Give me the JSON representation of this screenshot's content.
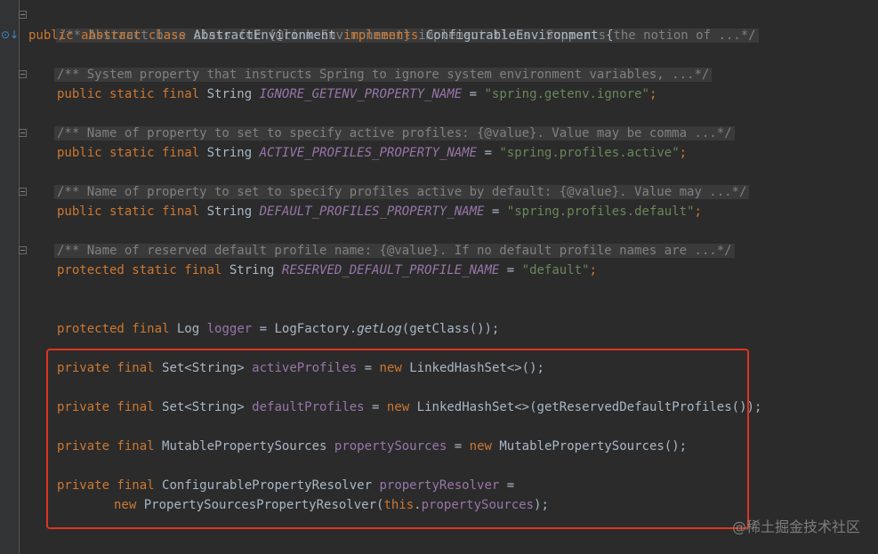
{
  "code": {
    "l1_comment": "/** Abstract base class for {@link Environment} implementations. Supports the notion of ...*/",
    "l2_public": "public",
    "l2_abstract": "abstract",
    "l2_class": "class",
    "l2_name": "AbstractEnvironment",
    "l2_implements": "implements",
    "l2_iface": "ConfigurableEnvironment {",
    "c1": "/** System property that instructs Spring to ignore system environment variables, ...*/",
    "d1_mods": "public static final",
    "d1_type": "String",
    "d1_name": "IGNORE_GETENV_PROPERTY_NAME",
    "d1_eq": "=",
    "d1_val": "\"spring.getenv.ignore\"",
    "c2": "/** Name of property to set to specify active profiles: {@value}. Value may be comma ...*/",
    "d2_mods": "public static final",
    "d2_type": "String",
    "d2_name": "ACTIVE_PROFILES_PROPERTY_NAME",
    "d2_eq": "=",
    "d2_val": "\"spring.profiles.active\"",
    "c3": "/** Name of property to set to specify profiles active by default: {@value}. Value may ...*/",
    "d3_mods": "public static final",
    "d3_type": "String",
    "d3_name": "DEFAULT_PROFILES_PROPERTY_NAME",
    "d3_eq": "=",
    "d3_val": "\"spring.profiles.default\"",
    "c4": "/** Name of reserved default profile name: {@value}. If no default profile names are ...*/",
    "d4_mods": "protected static final",
    "d4_type": "String",
    "d4_name": "RESERVED_DEFAULT_PROFILE_NAME",
    "d4_eq": "=",
    "d4_val": "\"default\"",
    "log_mods": "protected final",
    "log_type": "Log",
    "log_name": "logger",
    "log_rhs1": "= LogFactory.",
    "log_method": "getLog",
    "log_rhs2": "(getClass());",
    "f1_mods": "private final",
    "f1_type": "Set<String>",
    "f1_name": "activeProfiles",
    "f1_eq": "=",
    "f1_new": "new",
    "f1_rhs": "LinkedHashSet<>();",
    "f2_mods": "private final",
    "f2_type": "Set<String>",
    "f2_name": "defaultProfiles",
    "f2_eq": "=",
    "f2_new": "new",
    "f2_rhs": "LinkedHashSet<>(getReservedDefaultProfiles());",
    "f3_mods": "private final",
    "f3_type": "MutablePropertySources",
    "f3_name": "propertySources",
    "f3_eq": "=",
    "f3_new": "new",
    "f3_rhs": "MutablePropertySources();",
    "f4_mods": "private final",
    "f4_type": "ConfigurablePropertyResolver",
    "f4_name": "propertyResolver",
    "f4_eq": "=",
    "f4b_new": "new",
    "f4b_rhs1": "PropertySourcesPropertyResolver(",
    "f4b_this": "this",
    "f4b_dot": ".",
    "f4b_field": "propertySources",
    "f4b_end": ");"
  },
  "gutter": {
    "icon": "override-down-arrow-icon",
    "icon_glyph": "⊙↓"
  },
  "highlight": {
    "color": "#e0331f"
  },
  "watermark": "@稀土掘金技术社区"
}
